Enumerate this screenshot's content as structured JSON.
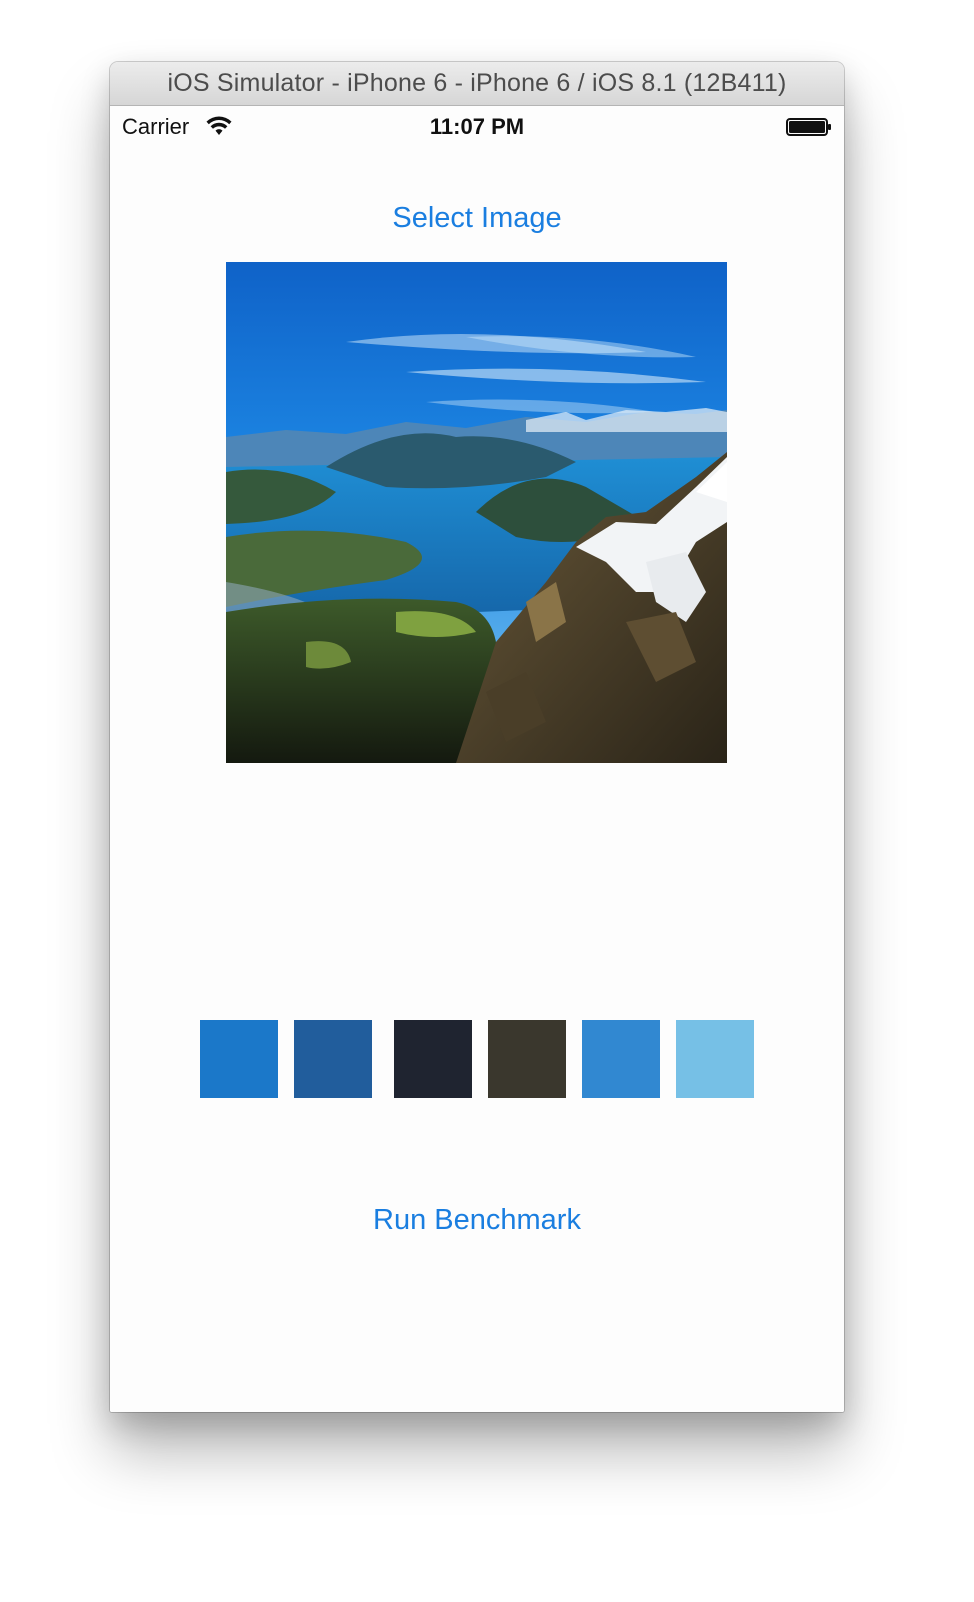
{
  "window": {
    "title": "iOS Simulator - iPhone 6 - iPhone 6 / iOS 8.1 (12B411)"
  },
  "status_bar": {
    "carrier": "Carrier",
    "time": "11:07 PM",
    "wifi_icon": "wifi-icon",
    "battery_icon": "battery-full-icon"
  },
  "app": {
    "select_image_label": "Select Image",
    "run_benchmark_label": "Run Benchmark",
    "accent_color": "#1a7ee0",
    "swatches": [
      {
        "color": "#1b78c9"
      },
      {
        "color": "#215d9c"
      },
      {
        "color": "#1f2430"
      },
      {
        "color": "#3a372d"
      },
      {
        "color": "#3188d1"
      },
      {
        "color": "#76c0e6"
      }
    ]
  }
}
